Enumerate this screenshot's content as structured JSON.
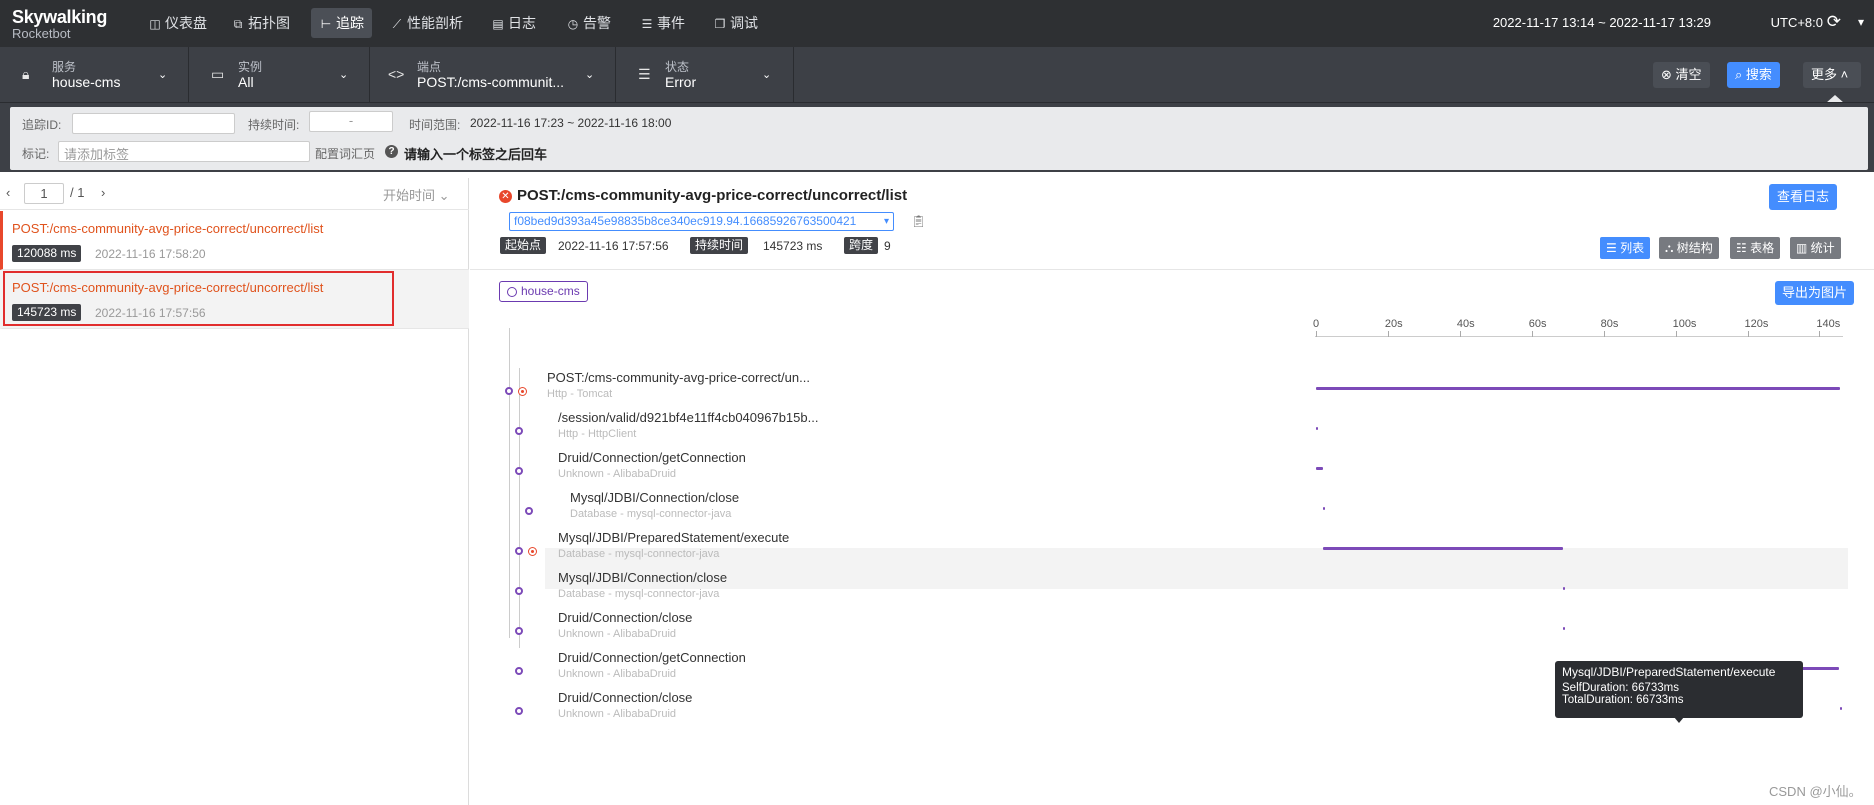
{
  "app": {
    "logo_top": "Skywalking",
    "logo_bottom": "Rocketbot"
  },
  "nav": [
    {
      "icon": "dashboard-icon",
      "glyph": "◫",
      "label": "仪表盘"
    },
    {
      "icon": "topology-icon",
      "glyph": "⧉",
      "label": "拓扑图"
    },
    {
      "icon": "trace-icon",
      "glyph": "⊢",
      "label": "追踪"
    },
    {
      "icon": "profile-icon",
      "glyph": "⟋",
      "label": "性能剖析"
    },
    {
      "icon": "log-icon",
      "glyph": "▤",
      "label": "日志"
    },
    {
      "icon": "alarm-icon",
      "glyph": "◷",
      "label": "告警"
    },
    {
      "icon": "event-icon",
      "glyph": "☰",
      "label": "事件"
    },
    {
      "icon": "debug-icon",
      "glyph": "❐",
      "label": "调试"
    }
  ],
  "header": {
    "time_range": "2022-11-17 13:14 ~ 2022-11-17 13:29",
    "timezone": "UTC+8:0",
    "reload_glyph": "⟳",
    "dropdown_glyph": "▾"
  },
  "filters": [
    {
      "label": "服务",
      "value": "house-cms",
      "icon": "lock-icon"
    },
    {
      "label": "实例",
      "value": "All",
      "icon": "monitor-icon"
    },
    {
      "label": "端点",
      "value": "POST:/cms-communit...",
      "icon": "code-icon"
    },
    {
      "label": "状态",
      "value": "Error",
      "icon": "stack-icon"
    }
  ],
  "actions": {
    "clear": "清空",
    "search": "搜索",
    "more": "更多"
  },
  "more": {
    "trace_id_label": "追踪ID:",
    "trace_id_value": "",
    "duration_label": "持续时间:",
    "duration_value": "-",
    "time_range_label": "时间范围:",
    "time_range_value": "2022-11-16 17:23 ~ 2022-11-16 18:00",
    "tags_label": "标记:",
    "tags_placeholder": "请添加标签",
    "config_label": "配置词汇页",
    "hint": "请输入一个标签之后回车"
  },
  "pager": {
    "page": "1",
    "total": "/ 1",
    "sort": "开始时间"
  },
  "traces": [
    {
      "name": "POST:/cms-community-avg-price-correct/uncorrect/list",
      "duration": "120088 ms",
      "time": "2022-11-16 17:58:20"
    },
    {
      "name": "POST:/cms-community-avg-price-correct/uncorrect/list",
      "duration": "145723 ms",
      "time": "2022-11-16 17:57:56"
    }
  ],
  "detail": {
    "title": "POST:/cms-community-avg-price-correct/uncorrect/list",
    "view_log": "查看日志",
    "trace_id": "f08bed9d393a45e98835b8ce340ec919.94.16685926763500421",
    "start_label": "起始点",
    "start_value": "2022-11-16 17:57:56",
    "duration_label": "持续时间",
    "duration_value": "145723 ms",
    "span_label": "跨度",
    "span_value": "9",
    "views": [
      "列表",
      "树结构",
      "表格",
      "统计"
    ],
    "service": "house-cms",
    "export": "导出为图片"
  },
  "axis_ticks": [
    "0",
    "20s",
    "40s",
    "60s",
    "80s",
    "100s",
    "120s",
    "140s"
  ],
  "chart_data": {
    "type": "bar",
    "xlabel": "",
    "xlim": [
      0,
      145723
    ],
    "categories": [
      "POST:/cms-community-avg-price-correct/un...",
      "/session/valid/d921bf4e11ff4cb040967b15b...",
      "Druid/Connection/getConnection",
      "Mysql/JDBI/Connection/close",
      "Mysql/JDBI/PreparedStatement/execute",
      "Mysql/JDBI/Connection/close",
      "Druid/Connection/close",
      "Druid/Connection/getConnection",
      "Druid/Connection/close"
    ],
    "series": [
      {
        "start_ms": [
          0,
          0,
          0,
          2000,
          2000,
          68800,
          68800,
          69000,
          145700
        ],
        "duration_ms": [
          145723,
          100,
          2000,
          0,
          66733,
          100,
          100,
          76500,
          50
        ]
      }
    ]
  },
  "spans": [
    {
      "name": "POST:/cms-community-avg-price-correct/un...",
      "sub": "Http - Tomcat",
      "error": true
    },
    {
      "name": "/session/valid/d921bf4e11ff4cb040967b15b...",
      "sub": "Http - HttpClient",
      "error": false
    },
    {
      "name": "Druid/Connection/getConnection",
      "sub": "Unknown - AlibabaDruid",
      "error": false
    },
    {
      "name": "Mysql/JDBI/Connection/close",
      "sub": "Database - mysql-connector-java",
      "error": false
    },
    {
      "name": "Mysql/JDBI/PreparedStatement/execute",
      "sub": "Database - mysql-connector-java",
      "error": true
    },
    {
      "name": "Mysql/JDBI/Connection/close",
      "sub": "Database - mysql-connector-java",
      "error": false
    },
    {
      "name": "Druid/Connection/close",
      "sub": "Unknown - AlibabaDruid",
      "error": false
    },
    {
      "name": "Druid/Connection/getConnection",
      "sub": "Unknown - AlibabaDruid",
      "error": false
    },
    {
      "name": "Druid/Connection/close",
      "sub": "Unknown - AlibabaDruid",
      "error": false
    }
  ],
  "tooltip": {
    "title": "Mysql/JDBI/PreparedStatement/execute",
    "self": "SelfDuration: 66733ms",
    "total": "TotalDuration: 66733ms"
  },
  "watermark": "CSDN @小仙。",
  "colors": {
    "accent": "#448dfe",
    "error": "#e8472b",
    "bar": "#7c4ab8",
    "nav_bg": "#2e3033"
  }
}
